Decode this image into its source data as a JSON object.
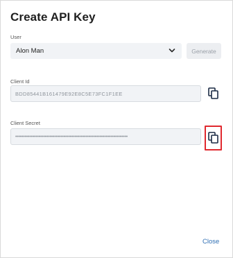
{
  "dialog": {
    "title": "Create API Key",
    "user_label": "User",
    "user_value": "Alon Man",
    "generate_label": "Generate",
    "client_id_label": "Client Id",
    "client_id_value": "BDD85441B161479E92E8C5E73FC1F1EE",
    "client_secret_label": "Client Secret",
    "client_secret_value": "••••••••••••••••••••••••••••••••••••••••••••••••••••••••••••••••••••••••",
    "close_label": "Close",
    "icons": {
      "dropdown": "chevron-down-icon",
      "copy_id": "copy-icon",
      "copy_secret": "copy-icon"
    },
    "colors": {
      "highlight": "#e0282e",
      "link": "#2f6fb3"
    }
  }
}
